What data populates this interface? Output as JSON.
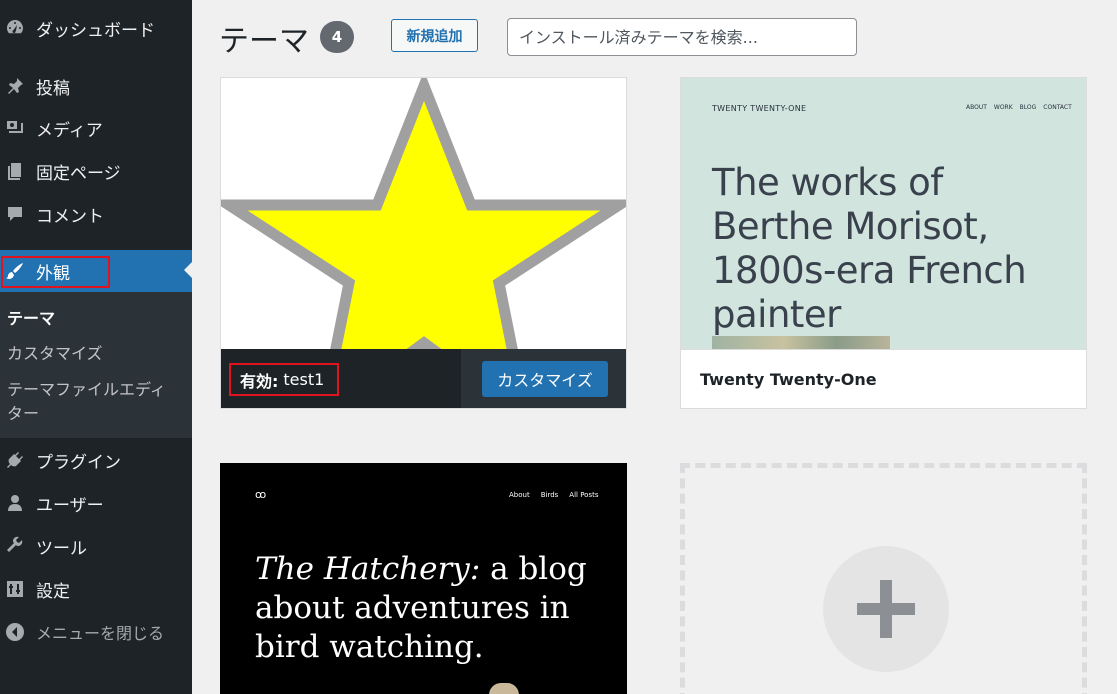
{
  "sidebar": {
    "items": [
      {
        "label": "ダッシュボード",
        "icon": "dashboard-icon"
      },
      {
        "label": "投稿",
        "icon": "pin-icon"
      },
      {
        "label": "メディア",
        "icon": "media-icon"
      },
      {
        "label": "固定ページ",
        "icon": "pages-icon"
      },
      {
        "label": "コメント",
        "icon": "comment-icon"
      },
      {
        "label": "外観",
        "icon": "paintbrush-icon",
        "active": true
      },
      {
        "label": "プラグイン",
        "icon": "plugin-icon"
      },
      {
        "label": "ユーザー",
        "icon": "user-icon"
      },
      {
        "label": "ツール",
        "icon": "wrench-icon"
      },
      {
        "label": "設定",
        "icon": "settings-icon"
      }
    ],
    "submenu": [
      {
        "label": "テーマ",
        "current": true
      },
      {
        "label": "カスタマイズ"
      },
      {
        "label": "テーマファイルエディ",
        "label2": "ター"
      }
    ],
    "collapse_label": "メニューを閉じる"
  },
  "header": {
    "title": "テーマ",
    "count": "4",
    "add_new_label": "新規追加",
    "search_placeholder": "インストール済みテーマを検索..."
  },
  "themes": {
    "active": {
      "status_label": "有効:",
      "name": "test1",
      "customize_label": "カスタマイズ"
    },
    "tt1": {
      "preview_site_title": "TWENTY TWENTY-ONE",
      "preview_nav": [
        "ABOUT",
        "WORK",
        "BLOG",
        "CONTACT"
      ],
      "preview_headline": "The works of Berthe Morisot, 1800s-era French painter",
      "name": "Twenty Twenty-One"
    },
    "hatchery": {
      "preview_logo": "ꝏ",
      "preview_nav": [
        "About",
        "Birds",
        "All Posts"
      ],
      "preview_headline_italic": "The Hatchery:",
      "preview_headline_rest": " a blog about adventures in bird watching."
    }
  },
  "colors": {
    "sidebar_bg": "#1d2327",
    "accent": "#2271b1",
    "highlight_outline": "#e0141e",
    "star_fill": "#ffff00",
    "star_stroke": "#a0a0a0"
  }
}
